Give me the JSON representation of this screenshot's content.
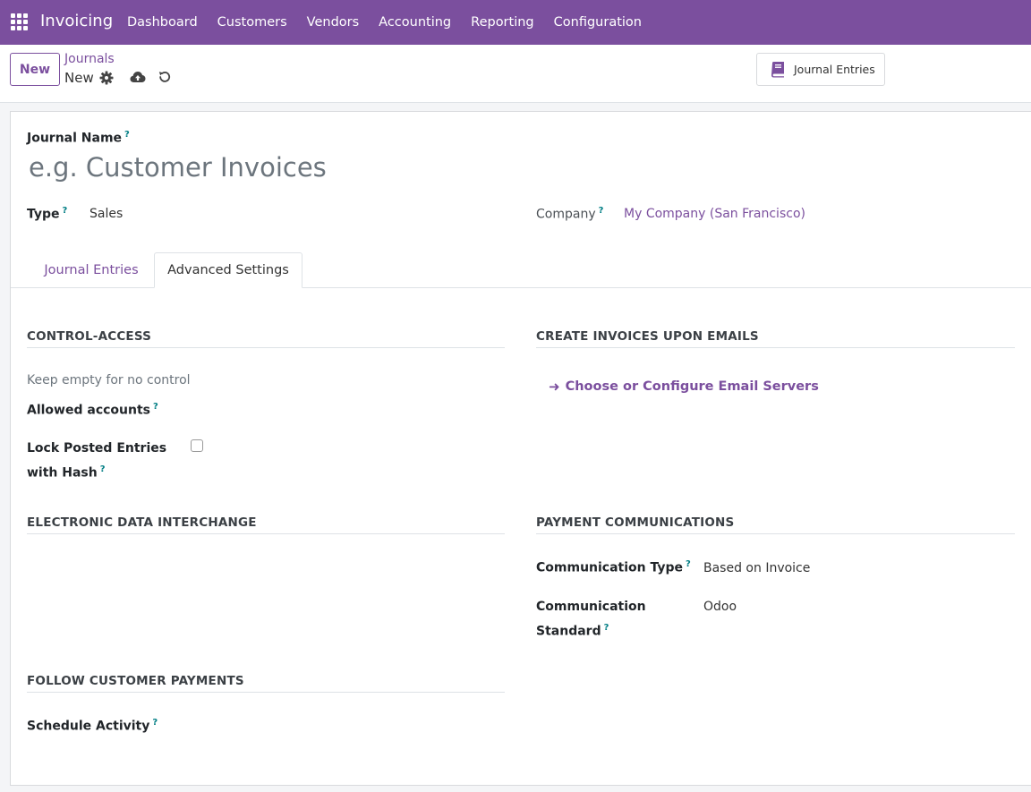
{
  "navbar": {
    "app_name": "Invoicing",
    "menu": [
      "Dashboard",
      "Customers",
      "Vendors",
      "Accounting",
      "Reporting",
      "Configuration"
    ],
    "bg_color": "#7b4f9e"
  },
  "control_panel": {
    "new_button": "New",
    "breadcrumb_parent": "Journals",
    "breadcrumb_current": "New",
    "smart_button_label": "Journal Entries"
  },
  "form": {
    "journal_name_label": "Journal Name",
    "journal_name_placeholder": "e.g. Customer Invoices",
    "type_label": "Type",
    "type_value": "Sales",
    "company_label": "Company",
    "company_value": "My Company (San Francisco)",
    "help_marker": "?"
  },
  "tabs": [
    {
      "label": "Journal Entries",
      "active": false
    },
    {
      "label": "Advanced Settings",
      "active": true
    }
  ],
  "sections": {
    "control_access": {
      "title": "CONTROL-ACCESS",
      "help_text": "Keep empty for no control",
      "allowed_accounts_label": "Allowed accounts",
      "lock_label_line1": "Lock Posted Entries",
      "lock_label_line2": "with Hash",
      "lock_checked": false
    },
    "create_invoices": {
      "title": "CREATE INVOICES UPON EMAILS",
      "link_text": "Choose or Configure Email Servers"
    },
    "edi": {
      "title": "ELECTRONIC DATA INTERCHANGE"
    },
    "payment_communications": {
      "title": "PAYMENT COMMUNICATIONS",
      "comm_type_label": "Communication Type",
      "comm_type_value": "Based on Invoice",
      "comm_standard_label_line1": "Communication",
      "comm_standard_label_line2": "Standard",
      "comm_standard_value": "Odoo"
    },
    "follow_payments": {
      "title": "FOLLOW CUSTOMER PAYMENTS",
      "schedule_activity_label": "Schedule Activity"
    }
  }
}
